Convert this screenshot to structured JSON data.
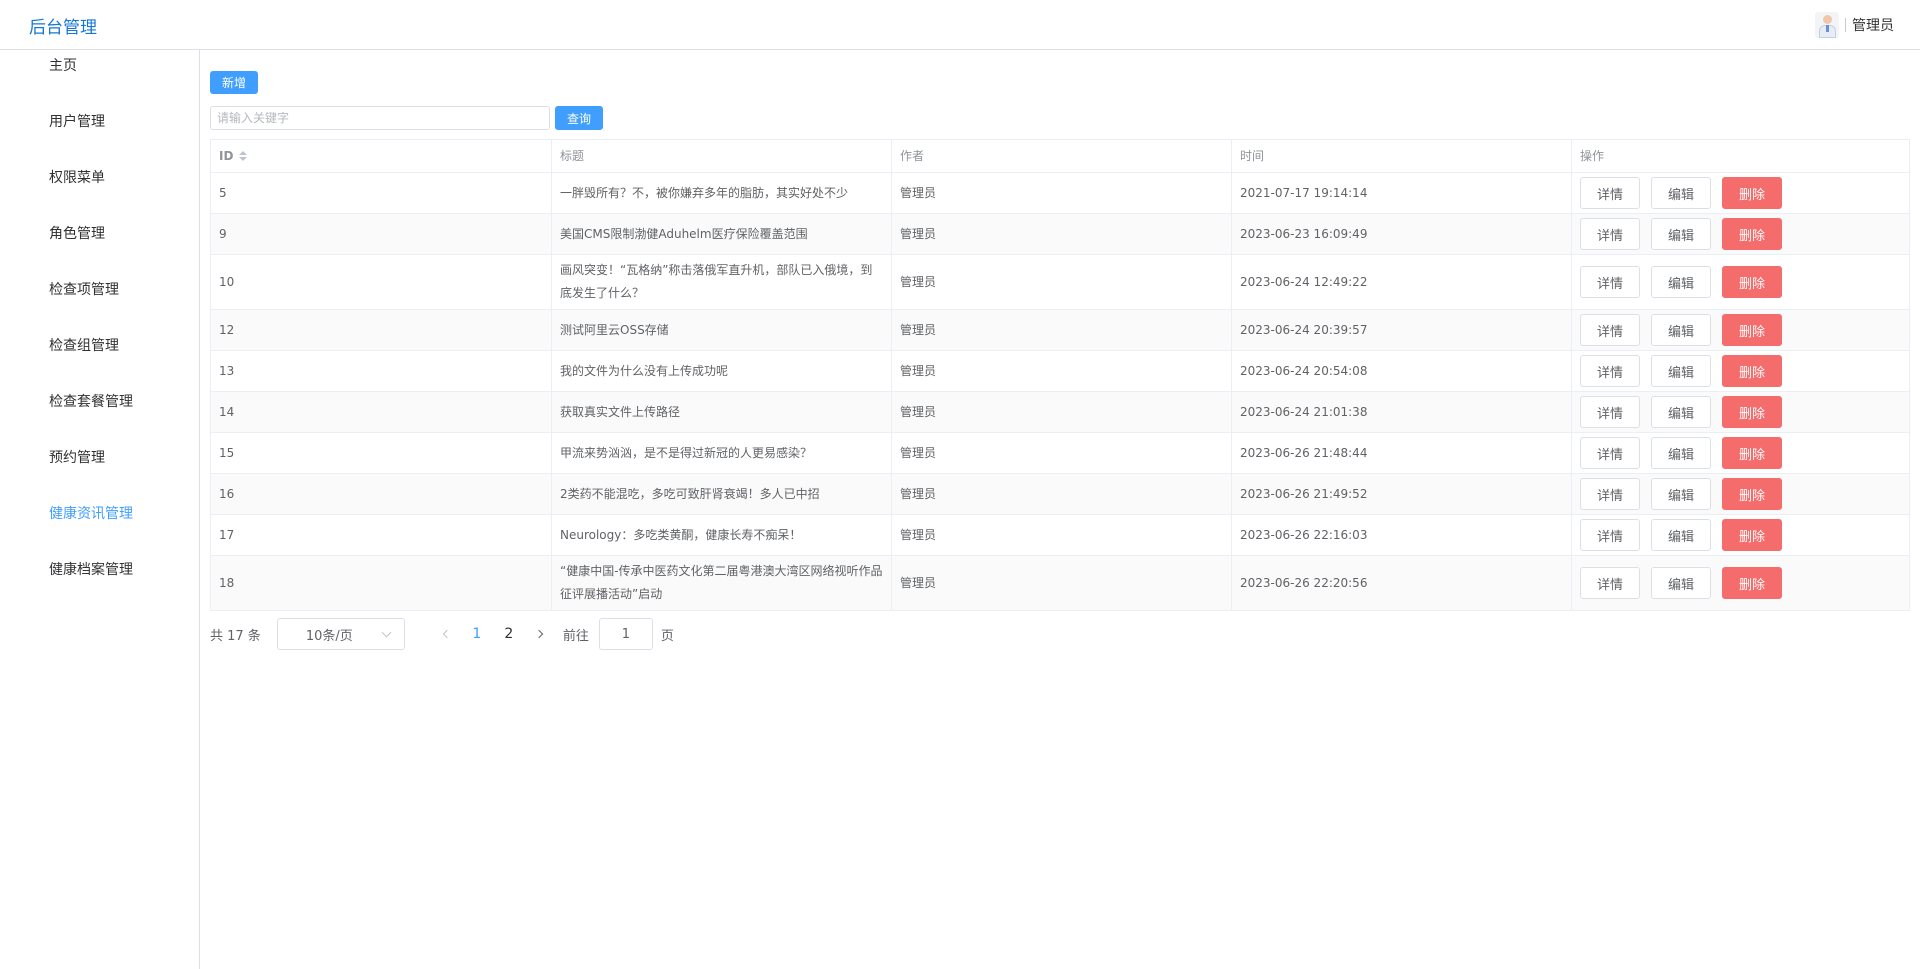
{
  "header": {
    "brand": "后台管理",
    "user_name": "管理员",
    "avatar_icon": "user-avatar-icon"
  },
  "sidebar": {
    "items": [
      {
        "label": "主页",
        "active": false
      },
      {
        "label": "用户管理",
        "active": false
      },
      {
        "label": "权限菜单",
        "active": false
      },
      {
        "label": "角色管理",
        "active": false
      },
      {
        "label": "检查项管理",
        "active": false
      },
      {
        "label": "检查组管理",
        "active": false
      },
      {
        "label": "检查套餐管理",
        "active": false
      },
      {
        "label": "预约管理",
        "active": false
      },
      {
        "label": "健康资讯管理",
        "active": true
      },
      {
        "label": "健康档案管理",
        "active": false
      }
    ]
  },
  "toolbar": {
    "add_label": "新增",
    "search_placeholder": "请输入关键字",
    "search_value": "",
    "query_label": "查询"
  },
  "table": {
    "columns": [
      "ID",
      "标题",
      "作者",
      "时间",
      "操作"
    ],
    "action_labels": {
      "detail": "详情",
      "edit": "编辑",
      "delete": "删除"
    },
    "rows": [
      {
        "id": "5",
        "title": "一胖毁所有？不，被你嫌弃多年的脂肪，其实好处不少",
        "author": "管理员",
        "time": "2021-07-17 19:14:14"
      },
      {
        "id": "9",
        "title": "美国CMS限制渤健Aduhelm医疗保险覆盖范围",
        "author": "管理员",
        "time": "2023-06-23 16:09:49"
      },
      {
        "id": "10",
        "title": "画风突变！“瓦格纳”称击落俄军直升机，部队已入俄境，到底发生了什么？",
        "author": "管理员",
        "time": "2023-06-24 12:49:22"
      },
      {
        "id": "12",
        "title": "测试阿里云OSS存储",
        "author": "管理员",
        "time": "2023-06-24 20:39:57"
      },
      {
        "id": "13",
        "title": "我的文件为什么没有上传成功呢",
        "author": "管理员",
        "time": "2023-06-24 20:54:08"
      },
      {
        "id": "14",
        "title": "获取真实文件上传路径",
        "author": "管理员",
        "time": "2023-06-24 21:01:38"
      },
      {
        "id": "15",
        "title": "甲流来势汹汹，是不是得过新冠的人更易感染？",
        "author": "管理员",
        "time": "2023-06-26 21:48:44"
      },
      {
        "id": "16",
        "title": "2类药不能混吃，多吃可致肝肾衰竭！多人已中招",
        "author": "管理员",
        "time": "2023-06-26 21:49:52"
      },
      {
        "id": "17",
        "title": "Neurology：多吃类黄酮，健康长寿不痴呆！",
        "author": "管理员",
        "time": "2023-06-26 22:16:03"
      },
      {
        "id": "18",
        "title": "“健康中国-传承中医药文化第二届粤港澳大湾区网络视听作品征评展播活动”启动",
        "author": "管理员",
        "time": "2023-06-26 22:20:56"
      }
    ]
  },
  "pagination": {
    "total_text": "共 17 条",
    "page_size": "10条/页",
    "pages": [
      "1",
      "2"
    ],
    "current_page": "1",
    "goto_prefix": "前往",
    "goto_value": "1",
    "goto_suffix": "页"
  },
  "colors": {
    "primary": "#409eff",
    "danger": "#f56c6c",
    "brand": "#1677d6"
  }
}
